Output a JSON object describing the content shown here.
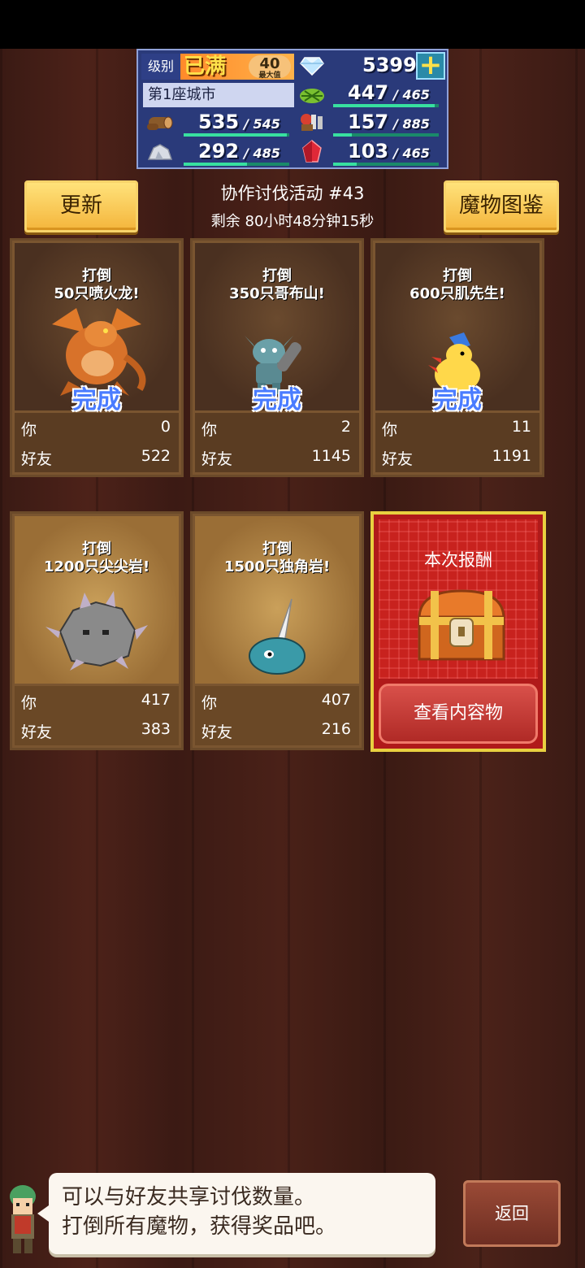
{
  "stats": {
    "level_label": "级别",
    "level_value": "已满",
    "level_badge": "40",
    "level_badge_sub": "最大值",
    "city": "第1座城市",
    "gems": "5399",
    "resources": [
      {
        "icon": "wood-log-icon",
        "value": "535",
        "max": "545",
        "fill": 0.98
      },
      {
        "icon": "stone-icon",
        "value": "292",
        "max": "485",
        "fill": 0.6
      },
      {
        "icon": "crop-icon",
        "value": "447",
        "max": "465",
        "fill": 0.96
      },
      {
        "icon": "food-basket-icon",
        "value": "157",
        "max": "885",
        "fill": 0.18
      },
      {
        "icon": "red-crystal-icon",
        "value": "103",
        "max": "465",
        "fill": 0.22
      }
    ]
  },
  "header": {
    "refresh_label": "更新",
    "title": "协作讨伐活动 #43",
    "timer": "剩余 80小时48分钟15秒",
    "bestiary_label": "魔物图鉴"
  },
  "cards": [
    {
      "goal_line1": "打倒",
      "goal_line2": "50只喷火龙!",
      "done": "完成",
      "you_label": "你",
      "you_value": "0",
      "friend_label": "好友",
      "friend_value": "522",
      "monster": "fire-dragon-icon"
    },
    {
      "goal_line1": "打倒",
      "goal_line2": "350只哥布山!",
      "done": "完成",
      "you_label": "你",
      "you_value": "2",
      "friend_label": "好友",
      "friend_value": "1145",
      "monster": "goblin-icon"
    },
    {
      "goal_line1": "打倒",
      "goal_line2": "600只肌先生!",
      "done": "完成",
      "you_label": "你",
      "you_value": "11",
      "friend_label": "好友",
      "friend_value": "1191",
      "monster": "chick-icon"
    },
    {
      "goal_line1": "打倒",
      "goal_line2": "1200只尖尖岩!",
      "done": "",
      "you_label": "你",
      "you_value": "417",
      "friend_label": "好友",
      "friend_value": "383",
      "monster": "spiky-rock-icon"
    },
    {
      "goal_line1": "打倒",
      "goal_line2": "1500只独角岩!",
      "done": "",
      "you_label": "你",
      "you_value": "407",
      "friend_label": "好友",
      "friend_value": "216",
      "monster": "horned-slime-icon"
    }
  ],
  "reward": {
    "title": "本次报酬",
    "button": "查看内容物"
  },
  "dialog": {
    "line1": "可以与好友共享讨伐数量。",
    "line2": "打倒所有魔物，获得奖品吧。"
  },
  "back_label": "返回"
}
